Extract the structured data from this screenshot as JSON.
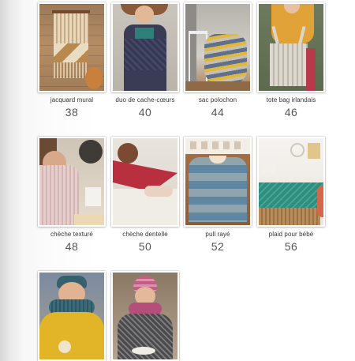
{
  "items": [
    {
      "title": "jacquard mural",
      "page": "38",
      "image": "wall-hanging-photo"
    },
    {
      "title": "duo de cache-cœurs",
      "page": "40",
      "image": "wrap-cardigan-photo"
    },
    {
      "title": "sac polochon",
      "page": "44",
      "image": "bucket-bag-photo"
    },
    {
      "title": "tote bag irlandais",
      "page": "46",
      "image": "tote-bag-photo"
    },
    {
      "title": "chèche texturé",
      "page": "48",
      "image": "textured-scarf-photo"
    },
    {
      "title": "chèche dentelle",
      "page": "50",
      "image": "lace-scarf-photo"
    },
    {
      "title": "pull rayé",
      "page": "52",
      "image": "striped-sweater-photo"
    },
    {
      "title": "plaid pour bébé",
      "page": "56",
      "image": "baby-blanket-photo"
    },
    {
      "title": "",
      "page": "",
      "image": "headband-cowl-photo"
    },
    {
      "title": "",
      "page": "",
      "image": "beanie-cowl-photo"
    }
  ]
}
